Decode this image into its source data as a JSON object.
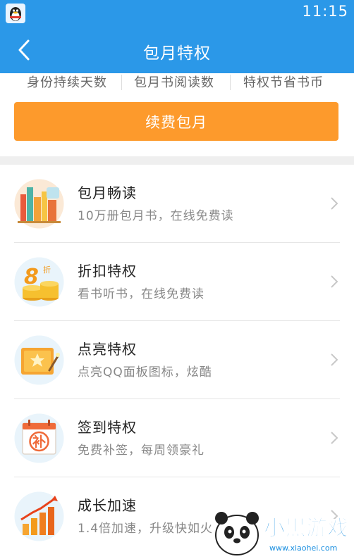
{
  "status_bar": {
    "time": "11:15",
    "app_icon": "qq-penguin-icon"
  },
  "nav": {
    "back_icon": "chevron-left-icon",
    "title": "包月特权"
  },
  "stats": {
    "labels": [
      "身份持续天数",
      "包月书阅读数",
      "特权节省书币"
    ]
  },
  "renew_button": {
    "label": "续费包月",
    "color": "#fd9a2c"
  },
  "colors": {
    "header": "#2b98e8",
    "accent_orange": "#fd9a2c"
  },
  "privileges": [
    {
      "title": "包月畅读",
      "desc": "10万册包月书，在线免费读",
      "icon": "bookshelf-icon"
    },
    {
      "title": "折扣特权",
      "desc": "看书听书，在线免费读",
      "icon": "discount-coins-icon",
      "icon_text": "8",
      "icon_badge": "折"
    },
    {
      "title": "点亮特权",
      "desc": "点亮QQ面板图标，炫酷",
      "icon": "light-up-card-icon"
    },
    {
      "title": "签到特权",
      "desc": "免费补签，每周领豪礼",
      "icon": "calendar-checkin-icon",
      "icon_text": "补"
    },
    {
      "title": "成长加速",
      "desc": "1.4倍加速，升级快如火",
      "icon": "growth-chart-icon"
    }
  ],
  "watermark": {
    "brand": "小黑游戏",
    "url": "www.xiaohei.com",
    "icon": "panda-mascot-icon"
  }
}
